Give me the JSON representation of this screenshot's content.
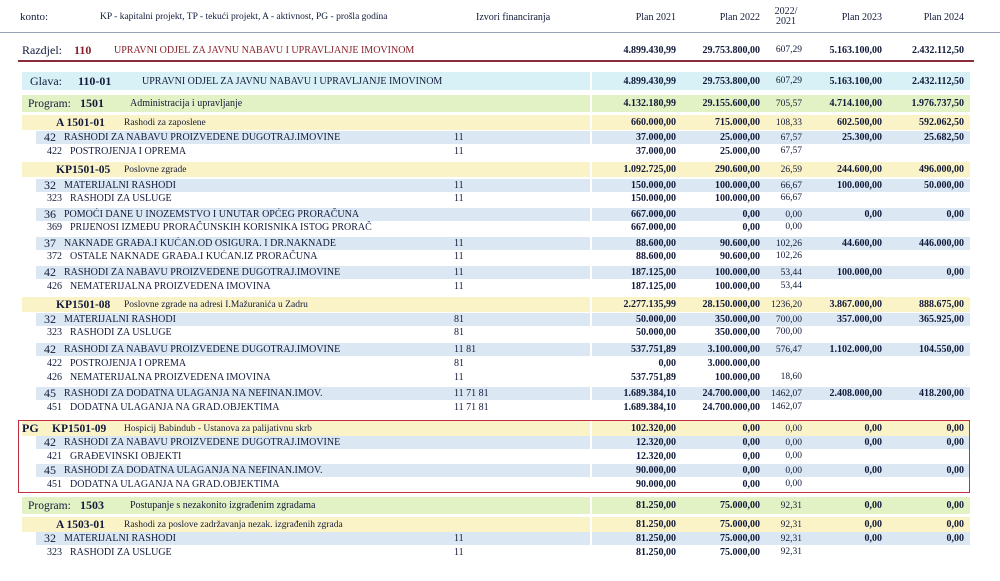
{
  "header": {
    "konto": "konto:",
    "legend": "KP - kapitalni projekt, TP - tekući projekt, A - aktivnost, PG - prošla godina",
    "izvori": "Izvori financiranja",
    "plan2021": "Plan 2021",
    "plan2022": "Plan 2022",
    "idx_top": "2022/",
    "idx_bottom": "2021",
    "plan2023": "Plan 2023",
    "plan2024": "Plan 2024"
  },
  "razdjel": {
    "label": "Razdjel:",
    "code": "110",
    "desc": "UPRAVNI ODJEL ZA JAVNU NABAVU I UPRAVLJANJE IMOVINOM",
    "p2021": "4.899.430,99",
    "p2022": "29.753.800,00",
    "idx": "607,29",
    "p2023": "5.163.100,00",
    "p2024": "2.432.112,50"
  },
  "glava": {
    "label": "Glava:",
    "code": "110-01",
    "desc": "UPRAVNI ODJEL ZA JAVNU NABAVU I UPRAVLJANJE IMOVINOM",
    "p2021": "4.899.430,99",
    "p2022": "29.753.800,00",
    "idx": "607,29",
    "p2023": "5.163.100,00",
    "p2024": "2.432.112,50"
  },
  "rows": [
    {
      "kind": "program",
      "label": "Program:",
      "code": "1501",
      "desc": "Administracija i upravljanje",
      "src": "",
      "p2021": "4.132.180,99",
      "p2022": "29.155.600,00",
      "idx": "705,57",
      "p2023": "4.714.100,00",
      "p2024": "1.976.737,50"
    },
    {
      "kind": "act",
      "code": "A 1501-01",
      "desc": "Rashodi za zaposlene",
      "src": "",
      "p2021": "660.000,00",
      "p2022": "715.000,00",
      "idx": "108,33",
      "p2023": "602.500,00",
      "p2024": "592.062,50"
    },
    {
      "kind": "l2",
      "code": "42",
      "desc": "RASHODI ZA NABAVU PROIZVEDENE DUGOTRAJ.IMOVINE",
      "src": "11",
      "p2021": "37.000,00",
      "p2022": "25.000,00",
      "idx": "67,57",
      "p2023": "25.300,00",
      "p2024": "25.682,50"
    },
    {
      "kind": "l3",
      "code": "422",
      "desc": "POSTROJENJA I OPREMA",
      "src": "11",
      "p2021": "37.000,00",
      "p2022": "25.000,00",
      "idx": "67,57",
      "p2023": "",
      "p2024": ""
    },
    {
      "kind": "act",
      "code": "KP1501-05",
      "desc": "Poslovne zgrade",
      "src": "",
      "p2021": "1.092.725,00",
      "p2022": "290.600,00",
      "idx": "26,59",
      "p2023": "244.600,00",
      "p2024": "496.000,00"
    },
    {
      "kind": "l2",
      "code": "32",
      "desc": "MATERIJALNI RASHODI",
      "src": "11",
      "p2021": "150.000,00",
      "p2022": "100.000,00",
      "idx": "66,67",
      "p2023": "100.000,00",
      "p2024": "50.000,00"
    },
    {
      "kind": "l3",
      "code": "323",
      "desc": "RASHODI ZA USLUGE",
      "src": "11",
      "p2021": "150.000,00",
      "p2022": "100.000,00",
      "idx": "66,67",
      "p2023": "",
      "p2024": ""
    },
    {
      "kind": "l2",
      "code": "36",
      "desc": "POMOĆI DANE U INOZEMSTVO I UNUTAR OPĆEG PRORAČUNA",
      "src": "",
      "p2021": "667.000,00",
      "p2022": "0,00",
      "idx": "0,00",
      "p2023": "0,00",
      "p2024": "0,00"
    },
    {
      "kind": "l3",
      "code": "369",
      "desc": "PRIJENOSI IZMEĐU PRORAČUNSKIH KORISNIKA ISTOG PRORAČ",
      "src": "",
      "p2021": "667.000,00",
      "p2022": "0,00",
      "idx": "0,00",
      "p2023": "",
      "p2024": ""
    },
    {
      "kind": "l2",
      "code": "37",
      "desc": "NAKNADE GRAĐA.I KUĆAN.OD OSIGURA. I DR.NAKNADE",
      "src": "11",
      "p2021": "88.600,00",
      "p2022": "90.600,00",
      "idx": "102,26",
      "p2023": "44.600,00",
      "p2024": "446.000,00"
    },
    {
      "kind": "l3",
      "code": "372",
      "desc": "OSTALE NAKNADE GRAĐA.I KUĆAN.IZ PRORAČUNA",
      "src": "11",
      "p2021": "88.600,00",
      "p2022": "90.600,00",
      "idx": "102,26",
      "p2023": "",
      "p2024": ""
    },
    {
      "kind": "l2",
      "code": "42",
      "desc": "RASHODI ZA NABAVU PROIZVEDENE DUGOTRAJ.IMOVINE",
      "src": "11",
      "p2021": "187.125,00",
      "p2022": "100.000,00",
      "idx": "53,44",
      "p2023": "100.000,00",
      "p2024": "0,00"
    },
    {
      "kind": "l3",
      "code": "426",
      "desc": "NEMATERIJALNA PROIZVEDENA IMOVINA",
      "src": "11",
      "p2021": "187.125,00",
      "p2022": "100.000,00",
      "idx": "53,44",
      "p2023": "",
      "p2024": ""
    },
    {
      "kind": "act",
      "code": "KP1501-08",
      "desc": "Poslovne zgrade na adresi I.Mažuranića u Zadru",
      "src": "",
      "p2021": "2.277.135,99",
      "p2022": "28.150.000,00",
      "idx": "1236,20",
      "p2023": "3.867.000,00",
      "p2024": "888.675,00"
    },
    {
      "kind": "l2",
      "code": "32",
      "desc": "MATERIJALNI RASHODI",
      "src": "81",
      "p2021": "50.000,00",
      "p2022": "350.000,00",
      "idx": "700,00",
      "p2023": "357.000,00",
      "p2024": "365.925,00"
    },
    {
      "kind": "l3",
      "code": "323",
      "desc": "RASHODI ZA USLUGE",
      "src": "81",
      "p2021": "50.000,00",
      "p2022": "350.000,00",
      "idx": "700,00",
      "p2023": "",
      "p2024": ""
    },
    {
      "kind": "l2",
      "code": "42",
      "desc": "RASHODI ZA NABAVU PROIZVEDENE DUGOTRAJ.IMOVINE",
      "src": "11 81",
      "p2021": "537.751,89",
      "p2022": "3.100.000,00",
      "idx": "576,47",
      "p2023": "1.102.000,00",
      "p2024": "104.550,00"
    },
    {
      "kind": "l3",
      "code": "422",
      "desc": "POSTROJENJA I OPREMA",
      "src": "81",
      "p2021": "0,00",
      "p2022": "3.000.000,00",
      "idx": "",
      "p2023": "",
      "p2024": ""
    },
    {
      "kind": "l3",
      "code": "426",
      "desc": "NEMATERIJALNA PROIZVEDENA IMOVINA",
      "src": "11",
      "p2021": "537.751,89",
      "p2022": "100.000,00",
      "idx": "18,60",
      "p2023": "",
      "p2024": ""
    },
    {
      "kind": "l2",
      "code": "45",
      "desc": "RASHODI ZA DODATNA ULAGANJA NA NEFINAN.IMOV.",
      "src": "11 71 81",
      "p2021": "1.689.384,10",
      "p2022": "24.700.000,00",
      "idx": "1462,07",
      "p2023": "2.408.000,00",
      "p2024": "418.200,00"
    },
    {
      "kind": "l3",
      "code": "451",
      "desc": "DODATNA ULAGANJA NA GRAD.OBJEKTIMA",
      "src": "11 71 81",
      "p2021": "1.689.384,10",
      "p2022": "24.700.000,00",
      "idx": "1462,07",
      "p2023": "",
      "p2024": ""
    },
    {
      "kind": "act",
      "prefix": "PG",
      "code": "KP1501-09",
      "desc": "Hospicij Babindub - Ustanova za palijativnu skrb",
      "src": "",
      "p2021": "102.320,00",
      "p2022": "0,00",
      "idx": "0,00",
      "p2023": "0,00",
      "p2024": "0,00"
    },
    {
      "kind": "l2",
      "code": "42",
      "desc": "RASHODI ZA NABAVU PROIZVEDENE DUGOTRAJ.IMOVINE",
      "src": "",
      "p2021": "12.320,00",
      "p2022": "0,00",
      "idx": "0,00",
      "p2023": "0,00",
      "p2024": "0,00"
    },
    {
      "kind": "l3",
      "code": "421",
      "desc": "GRAĐEVINSKI OBJEKTI",
      "src": "",
      "p2021": "12.320,00",
      "p2022": "0,00",
      "idx": "0,00",
      "p2023": "",
      "p2024": ""
    },
    {
      "kind": "l2",
      "code": "45",
      "desc": "RASHODI ZA DODATNA ULAGANJA NA NEFINAN.IMOV.",
      "src": "",
      "p2021": "90.000,00",
      "p2022": "0,00",
      "idx": "0,00",
      "p2023": "0,00",
      "p2024": "0,00"
    },
    {
      "kind": "l3",
      "code": "451",
      "desc": "DODATNA ULAGANJA NA GRAD.OBJEKTIMA",
      "src": "",
      "p2021": "90.000,00",
      "p2022": "0,00",
      "idx": "0,00",
      "p2023": "",
      "p2024": ""
    },
    {
      "kind": "program",
      "label": "Program:",
      "code": "1503",
      "desc": "Postupanje s nezakonito izgrađenim zgradama",
      "src": "",
      "p2021": "81.250,00",
      "p2022": "75.000,00",
      "idx": "92,31",
      "p2023": "0,00",
      "p2024": "0,00"
    },
    {
      "kind": "act",
      "code": "A 1503-01",
      "desc": "Rashodi za poslove zadržavanja nezak. izgrađenih zgrada",
      "src": "",
      "p2021": "81.250,00",
      "p2022": "75.000,00",
      "idx": "92,31",
      "p2023": "0,00",
      "p2024": "0,00"
    },
    {
      "kind": "l2",
      "code": "32",
      "desc": "MATERIJALNI RASHODI",
      "src": "11",
      "p2021": "81.250,00",
      "p2022": "75.000,00",
      "idx": "92,31",
      "p2023": "0,00",
      "p2024": "0,00"
    },
    {
      "kind": "l3",
      "code": "323",
      "desc": "RASHODI ZA USLUGE",
      "src": "11",
      "p2021": "81.250,00",
      "p2022": "75.000,00",
      "idx": "92,31",
      "p2023": "",
      "p2024": ""
    }
  ]
}
